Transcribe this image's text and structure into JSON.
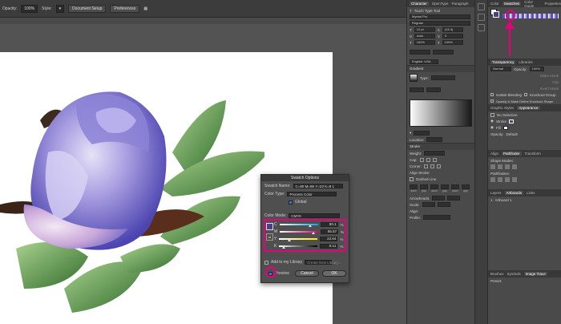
{
  "control_bar": {
    "opacity_label": "Opacity:",
    "opacity_value": "100%",
    "style_label": "Style:",
    "doc_setup": "Document Setup",
    "preferences": "Preferences"
  },
  "swatch_dialog": {
    "title": "Swatch Options",
    "swatch_name_label": "Swatch Name:",
    "swatch_name_value": "C=80 M=86 Y=23 K=8 1",
    "color_type_label": "Color Type:",
    "color_type_value": "Process Color",
    "global_label": "Global",
    "color_mode_label": "Color Mode:",
    "color_mode_value": "CMYK",
    "channels": [
      {
        "label": "C",
        "value": "80.1",
        "fraction": 0.801
      },
      {
        "label": "M",
        "value": "85.57",
        "fraction": 0.8557
      },
      {
        "label": "Y",
        "value": "22.64",
        "fraction": 0.2264
      },
      {
        "label": "K",
        "value": "8.11",
        "fraction": 0.0811
      }
    ],
    "percent": "%",
    "add_library_label": "Add to my Library",
    "create_library": "Create New Library...",
    "preview_label": "Preview",
    "cancel": "Cancel",
    "ok": "OK"
  },
  "character_panel": {
    "tabs": [
      "Character",
      "OpenType",
      "Paragraph"
    ],
    "touch_type": "Touch Type Tool",
    "font": "Myriad Pro",
    "style": "Regular",
    "size": "12 pt",
    "leading": "(14.4)",
    "kerning": "Auto",
    "tracking": "0",
    "scale_h": "100%",
    "scale_v": "100%",
    "language": "English: USA"
  },
  "gradient_panel": {
    "title": "Gradient",
    "type_label": "Type:",
    "location_label": "Location:"
  },
  "stroke_panel": {
    "title": "Stroke",
    "weight_label": "Weight:",
    "cap_label": "Cap:",
    "corner_label": "Corner:",
    "align_label": "Align Stroke:",
    "dashed": "Dashed Line",
    "dash_fields": [
      "dash",
      "gap",
      "dash",
      "gap",
      "dash",
      "gap"
    ],
    "arrowheads": "Arrowheads:",
    "scale": "Scale:",
    "align2": "Align:",
    "profile": "Profile:"
  },
  "swatches_panel": {
    "tabs": [
      "Color",
      "Swatches",
      "Color Guide",
      "Properties"
    ]
  },
  "transparency_panel": {
    "tabs": [
      "Transparency",
      "Libraries"
    ],
    "mode": "Normal",
    "opacity_label": "Opacity:",
    "opacity": "100%",
    "make_mask": "Make Mask",
    "clip": "Clip",
    "invert": "Invert Mask",
    "isolate": "Isolate Blending",
    "knockout": "Knockout Group",
    "define_knockout": "Opacity & Mask Define Knockout Shape"
  },
  "appearance_panel": {
    "tabs": [
      "Graphic Styles",
      "Appearance"
    ],
    "no_selection": "No Selection",
    "stroke": "Stroke",
    "fill": "Fill",
    "opacity": "Opacity:",
    "opacity_value": "Default"
  },
  "align_panel": {
    "tabs": [
      "Align",
      "Pathfinder",
      "Transform"
    ],
    "shape_modes": "Shape Modes:",
    "pathfinders": "Pathfinders:"
  },
  "layers_panel": {
    "tabs": [
      "Layers",
      "Artboards",
      "Links"
    ],
    "rows": [
      {
        "num": "1",
        "name": "Artboard 1"
      }
    ]
  },
  "bottom_tabs": {
    "tabs": [
      "Brushes",
      "Symbols",
      "Image Trace"
    ],
    "preset": "Preset:"
  },
  "colors": {
    "accent_pink": "#e6007e",
    "swatch_purple": "#4e3d8f"
  }
}
